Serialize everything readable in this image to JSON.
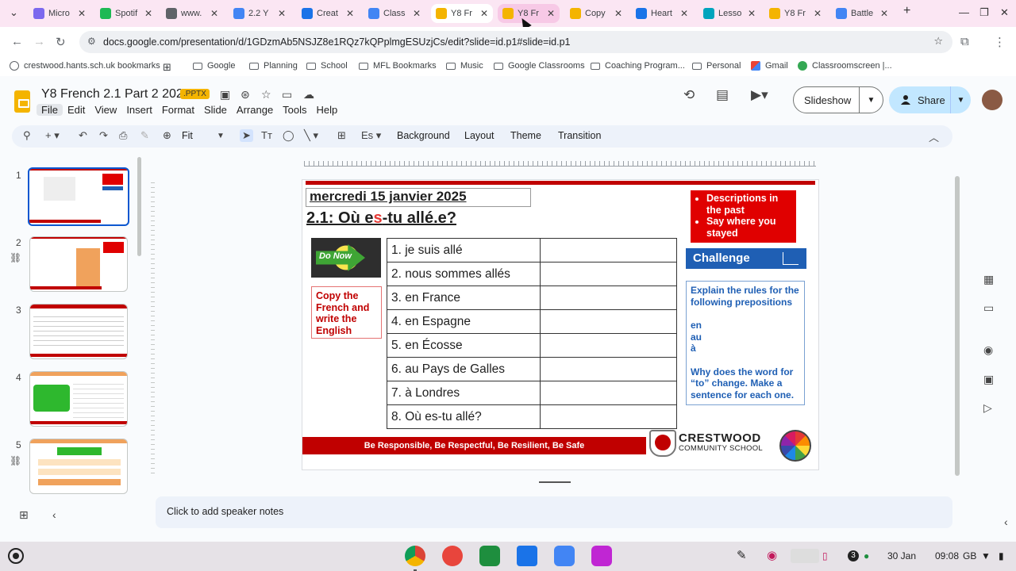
{
  "browser": {
    "tabs": [
      {
        "label": "Micro",
        "color": "#7b68ee"
      },
      {
        "label": "Spotif",
        "color": "#1db954"
      },
      {
        "label": "www.",
        "color": "#5f6368"
      },
      {
        "label": "2.2 Y",
        "color": "#4285f4"
      },
      {
        "label": "Creat",
        "color": "#1a73e8"
      },
      {
        "label": "Class",
        "color": "#4285f4"
      },
      {
        "label": "Y8 Fr",
        "color": "#f4b400"
      },
      {
        "label": "Y8 Fr",
        "color": "#f4b400"
      },
      {
        "label": "Copy",
        "color": "#f4b400"
      },
      {
        "label": "Heart",
        "color": "#1a73e8"
      },
      {
        "label": "Lesso",
        "color": "#00a4bd"
      },
      {
        "label": "Y8 Fr",
        "color": "#f4b400"
      },
      {
        "label": "Battle",
        "color": "#4285f4"
      }
    ],
    "url": "docs.google.com/presentation/d/1GDzmAb5NSJZ8e1RQz7kQPplmgESUzjCs/edit?slide=id.p1#slide=id.p1",
    "bookmarks": [
      {
        "label": "crestwood.hants.sch.uk bookmarks",
        "type": "globe"
      },
      {
        "label": "",
        "type": "apps"
      },
      {
        "label": "Google",
        "type": "folder"
      },
      {
        "label": "Planning",
        "type": "folder"
      },
      {
        "label": "School",
        "type": "folder"
      },
      {
        "label": "MFL Bookmarks",
        "type": "folder"
      },
      {
        "label": "Music",
        "type": "folder"
      },
      {
        "label": "Google Classrooms",
        "type": "folder"
      },
      {
        "label": "Coaching Program...",
        "type": "folder"
      },
      {
        "label": "Personal",
        "type": "folder"
      },
      {
        "label": "Gmail",
        "type": "gmail"
      },
      {
        "label": "Classroomscreen |...",
        "type": "site"
      }
    ]
  },
  "docs": {
    "title": "Y8 French 2.1 Part 2 2025",
    "badge": ".PPTX",
    "menus": [
      "File",
      "Edit",
      "View",
      "Insert",
      "Format",
      "Slide",
      "Arrange",
      "Tools",
      "Help"
    ],
    "slideshow_label": "Slideshow",
    "share_label": "Share",
    "zoom_label": "Fit",
    "toolbar_buttons": [
      "Background",
      "Layout",
      "Theme",
      "Transition"
    ],
    "speaker_notes_placeholder": "Click to add speaker notes"
  },
  "filmstrip": {
    "numbers": [
      "1",
      "2",
      "3",
      "4",
      "5"
    ]
  },
  "slide": {
    "date": "mercredi 15 janvier 2025",
    "title_prefix": "2.1: Où e",
    "title_red": "s",
    "title_suffix": "-tu allé.e?",
    "donow_label": "Do Now",
    "copy_instruction": "Copy the French and write the English",
    "vocab": [
      "1. je suis allé",
      "2. nous sommes allés",
      "3. en France",
      "4. en Espagne",
      "5. en Écosse",
      "6. au Pays de Galles",
      "7. à Londres",
      "8. Où es-tu allé?"
    ],
    "objectives": [
      "Descriptions in the past",
      "Say where you stayed"
    ],
    "challenge_title": "Challenge",
    "challenge_line1": "Explain the rules for the following prepositions",
    "prepositions": [
      "en",
      "au",
      "à"
    ],
    "challenge_line2": "Why does the word for “to” change. Make a sentence for each one.",
    "footer_motto": "Be Responsible, Be Respectful, Be Resilient, Be Safe",
    "school_name": "CRESTWOOD",
    "school_sub": "COMMUNITY SCHOOL"
  },
  "shelf": {
    "notification_count": "3",
    "date": "30 Jan",
    "time": "09:08",
    "locale": "GB"
  }
}
